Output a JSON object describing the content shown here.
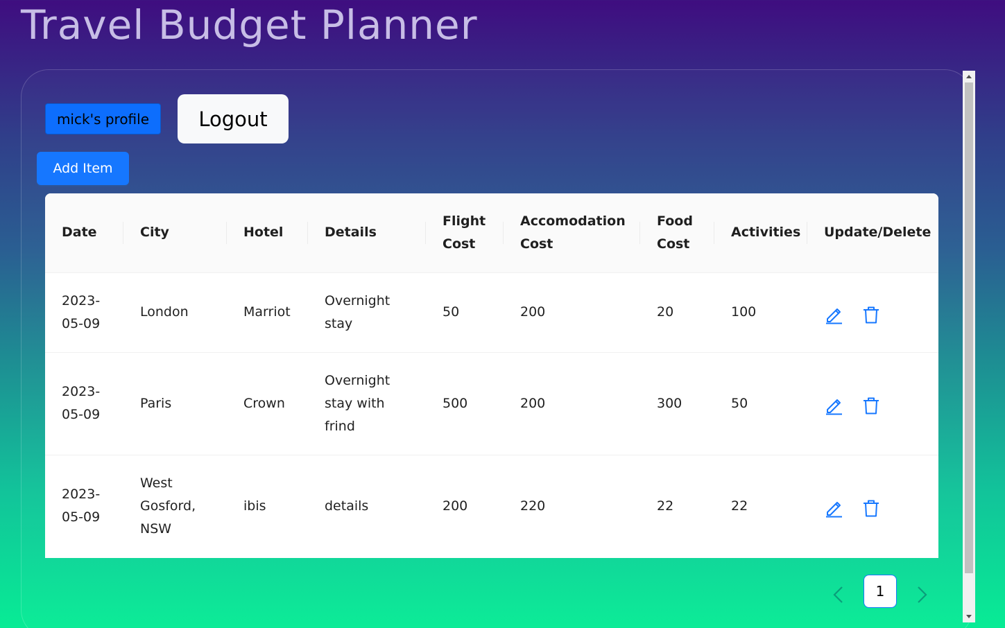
{
  "app": {
    "title": "Travel Budget Planner"
  },
  "header": {
    "profile_label": "mick's profile",
    "logout_label": "Logout",
    "add_item_label": "Add Item"
  },
  "table": {
    "columns": [
      "Date",
      "City",
      "Hotel",
      "Details",
      "Flight Cost",
      "Accomodation Cost",
      "Food Cost",
      "Activities",
      "Update/Delete"
    ],
    "rows": [
      {
        "date": "2023-05-09",
        "city": "London",
        "hotel": "Marriot",
        "details": "Overnight stay",
        "flight": "50",
        "accommodation": "200",
        "food": "20",
        "activities": "100"
      },
      {
        "date": "2023-05-09",
        "city": "Paris",
        "hotel": "Crown",
        "details": "Overnight stay with frind",
        "flight": "500",
        "accommodation": "200",
        "food": "300",
        "activities": "50"
      },
      {
        "date": "2023-05-09",
        "city": "West Gosford, NSW",
        "hotel": "ibis",
        "details": "details",
        "flight": "200",
        "accommodation": "220",
        "food": "22",
        "activities": "22"
      }
    ],
    "action_icons": [
      "edit-icon",
      "delete-icon"
    ]
  },
  "pagination": {
    "current_page": "1"
  },
  "colors": {
    "primary": "#1677ff",
    "profile_button": "#0d6efd",
    "title": "#c7bde6",
    "gradient_top": "#3f0d80",
    "gradient_bottom": "#08ec95"
  }
}
